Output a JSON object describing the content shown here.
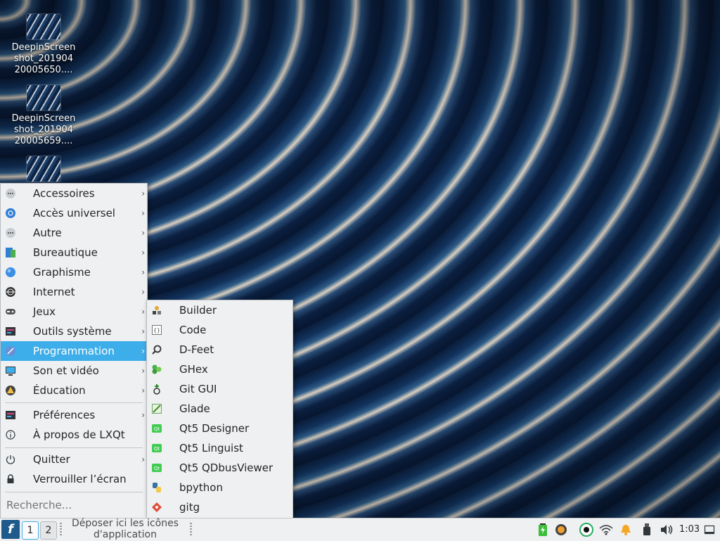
{
  "desktop": {
    "icons": [
      {
        "name": "DeepinScreen shot_201904 20005650...."
      },
      {
        "name": "DeepinScreen shot_201904 20005659...."
      }
    ]
  },
  "menu": {
    "items": [
      {
        "label": "Accessoires",
        "icon": "accessories-icon"
      },
      {
        "label": "Accès universel",
        "icon": "accessibility-icon"
      },
      {
        "label": "Autre",
        "icon": "other-icon"
      },
      {
        "label": "Bureautique",
        "icon": "office-icon"
      },
      {
        "label": "Graphisme",
        "icon": "graphics-icon"
      },
      {
        "label": "Internet",
        "icon": "internet-icon"
      },
      {
        "label": "Jeux",
        "icon": "games-icon"
      },
      {
        "label": "Outils système",
        "icon": "system-tools-icon"
      },
      {
        "label": "Programmation",
        "icon": "development-icon"
      },
      {
        "label": "Son et vidéo",
        "icon": "multimedia-icon"
      },
      {
        "label": "Éducation",
        "icon": "education-icon"
      }
    ],
    "preferences": "Préférences",
    "about": "À propos de LXQt",
    "quit": "Quitter",
    "lock": "Verrouiller l’écran",
    "search_placeholder": "Recherche..."
  },
  "submenu": {
    "items": [
      {
        "label": "Builder",
        "icon": "builder-icon"
      },
      {
        "label": "Code",
        "icon": "code-icon"
      },
      {
        "label": "D-Feet",
        "icon": "dfeet-icon"
      },
      {
        "label": "GHex",
        "icon": "ghex-icon"
      },
      {
        "label": "Git GUI",
        "icon": "git-gui-icon"
      },
      {
        "label": "Glade",
        "icon": "glade-icon"
      },
      {
        "label": "Qt5 Designer",
        "icon": "qt-designer-icon"
      },
      {
        "label": "Qt5 Linguist",
        "icon": "qt-linguist-icon"
      },
      {
        "label": "Qt5 QDbusViewer",
        "icon": "qt-dbusviewer-icon"
      },
      {
        "label": "bpython",
        "icon": "python-icon"
      },
      {
        "label": "gitg",
        "icon": "gitg-icon"
      }
    ]
  },
  "taskbar": {
    "workspaces": [
      "1",
      "2"
    ],
    "quicklaunch_hint": "Déposer ici les icônes d'application",
    "clock": "1:03"
  },
  "colors": {
    "accent": "#3daee9",
    "panel": "#eff0f1",
    "start": "#1e5a8c"
  }
}
